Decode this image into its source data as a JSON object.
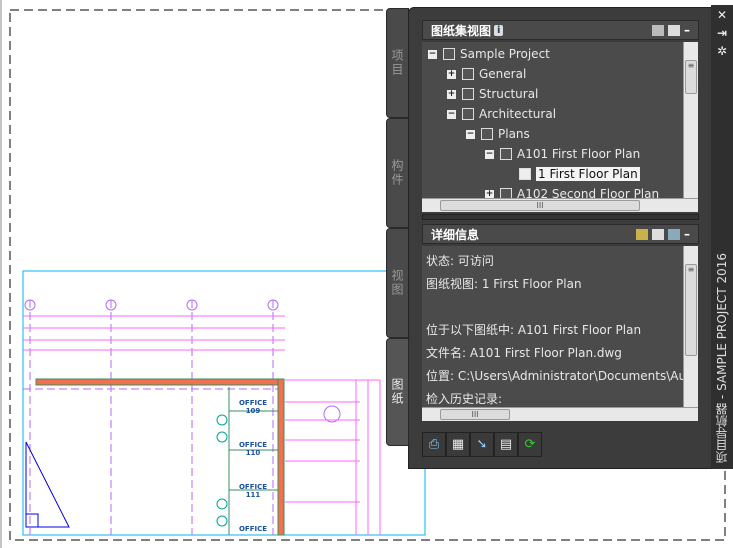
{
  "drawing": {
    "rooms": [
      {
        "name": "OFFICE",
        "number": "109"
      },
      {
        "name": "OFFICE",
        "number": "110"
      },
      {
        "name": "OFFICE",
        "number": "111"
      },
      {
        "name": "OFFICE",
        "number": ""
      }
    ]
  },
  "palette": {
    "title": "项目导航器 - SAMPLE PROJECT 2016",
    "tabs": [
      "项目",
      "构件",
      "视图",
      "图纸"
    ],
    "active_tab": "图纸",
    "sheet_set": {
      "header": "图纸集视图",
      "tree": [
        {
          "label": "Sample Project",
          "expander": "−",
          "level": 0
        },
        {
          "label": "General",
          "expander": "+",
          "level": 1
        },
        {
          "label": "Structural",
          "expander": "+",
          "level": 1
        },
        {
          "label": "Architectural",
          "expander": "−",
          "level": 1
        },
        {
          "label": "Plans",
          "expander": "−",
          "level": 2
        },
        {
          "label": "A101 First Floor Plan",
          "expander": "−",
          "level": 3
        },
        {
          "label": "1 First Floor Plan",
          "expander": "",
          "level": 4,
          "selected": true
        },
        {
          "label": "A102 Second Floor Plan",
          "expander": "+",
          "level": 3
        }
      ]
    },
    "details": {
      "header": "详细信息",
      "lines": [
        "状态: 可访问",
        "图纸视图: 1 First Floor Plan",
        "",
        "位于以下图纸中: A101 First Floor Plan",
        "文件名: A101 First Floor Plan.dwg",
        "位置: C:\\Users\\Administrator\\Documents\\Au",
        "检入历史记录:"
      ]
    },
    "toolbar": [
      "publish-icon",
      "new-sheet-icon",
      "select-icon",
      "layout-icon",
      "refresh-icon"
    ],
    "colors": {
      "panel": "#3c3c3c",
      "viewport": "#00b4f0",
      "grid": "#b36bff",
      "dims": "#ff66ff"
    }
  }
}
